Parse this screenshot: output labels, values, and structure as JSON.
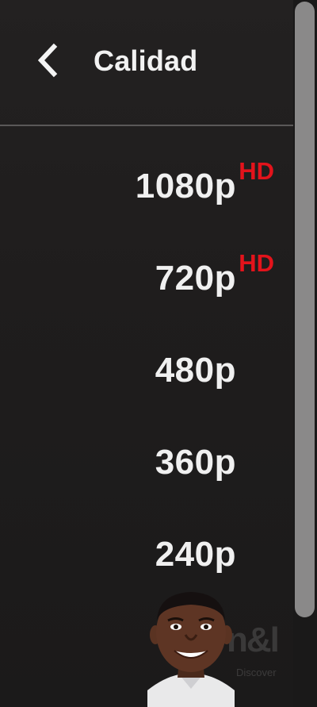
{
  "header": {
    "back_icon": "chevron-left-icon",
    "title": "Calidad"
  },
  "quality_options": [
    {
      "label": "1080p",
      "badge": "HD"
    },
    {
      "label": "720p",
      "badge": "HD"
    },
    {
      "label": "480p",
      "badge": ""
    },
    {
      "label": "360p",
      "badge": ""
    },
    {
      "label": "240p",
      "badge": ""
    }
  ],
  "overlay": {
    "watermark_text": "n&l",
    "watermark_sub": "Discover"
  },
  "colors": {
    "background": "#1c1b1b",
    "text": "#f0f0f0",
    "hd_badge": "#e3131b",
    "divider": "#5a5858",
    "scroll_thumb": "#8a8989"
  }
}
